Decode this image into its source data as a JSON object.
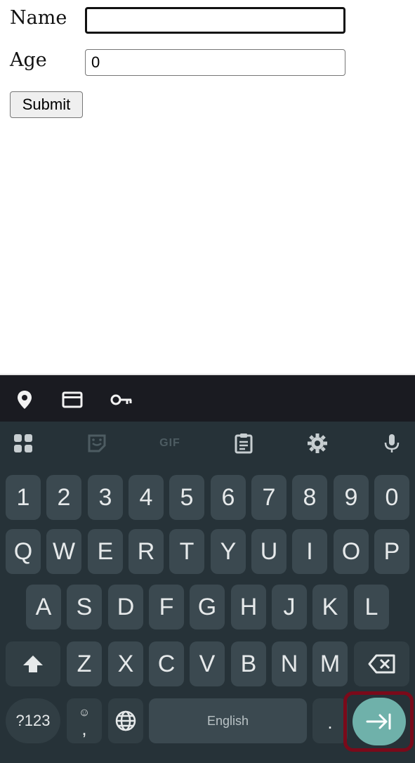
{
  "form": {
    "name_label": "Name",
    "name_value": "",
    "age_label": "Age",
    "age_value": "0",
    "submit_label": "Submit"
  },
  "keyboard": {
    "toolbar_icons": [
      "location-pin-icon",
      "card-icon",
      "key-icon"
    ],
    "tool_icons": [
      "apps-grid-icon",
      "sticker-icon",
      "gif-icon",
      "clipboard-icon",
      "gear-icon",
      "microphone-icon"
    ],
    "gif_label": "GIF",
    "number_row": [
      "1",
      "2",
      "3",
      "4",
      "5",
      "6",
      "7",
      "8",
      "9",
      "0"
    ],
    "row1": [
      "Q",
      "W",
      "E",
      "R",
      "T",
      "Y",
      "U",
      "I",
      "O",
      "P"
    ],
    "row2": [
      "A",
      "S",
      "D",
      "F",
      "G",
      "H",
      "J",
      "K",
      "L"
    ],
    "row3": [
      "Z",
      "X",
      "C",
      "V",
      "B",
      "N",
      "M"
    ],
    "symbols_label": "?123",
    "comma_label": ",",
    "emoji_hint": "☺",
    "space_label": "English",
    "period_label": ".",
    "colors": {
      "toolbar_bg": "#1a1b21",
      "keyboard_bg": "#263238",
      "key_bg": "#3b4950",
      "enter_bg": "#6fb1aa",
      "highlight_border": "#7a0a1a"
    }
  }
}
